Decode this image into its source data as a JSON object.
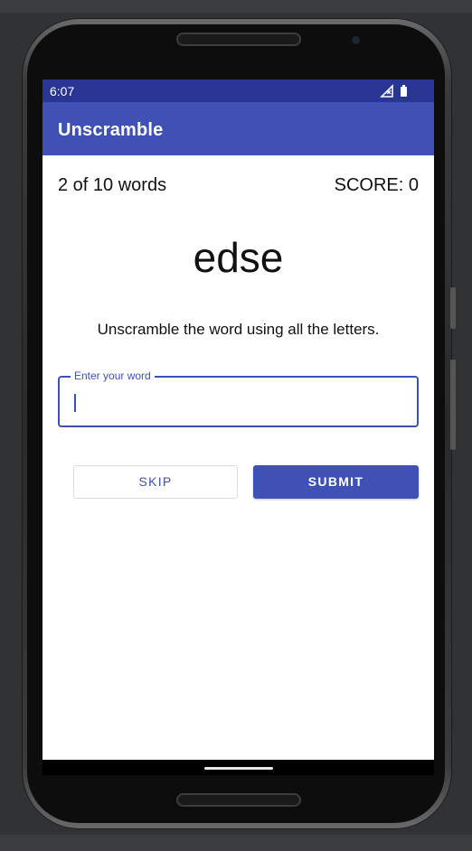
{
  "status_bar": {
    "time": "6:07",
    "icons": [
      "signal-icon",
      "battery-icon"
    ]
  },
  "app_bar": {
    "title": "Unscramble"
  },
  "game": {
    "word_count": "2 of 10 words",
    "score": "SCORE: 0",
    "scrambled_word": "edse",
    "instructions": "Unscramble the word using all the letters."
  },
  "input": {
    "label": "Enter your word",
    "value": ""
  },
  "buttons": {
    "skip_label": "SKIP",
    "submit_label": "SUBMIT"
  },
  "colors": {
    "primary": "#3f51b5",
    "primary_dark": "#283593",
    "background": "#ffffff"
  }
}
